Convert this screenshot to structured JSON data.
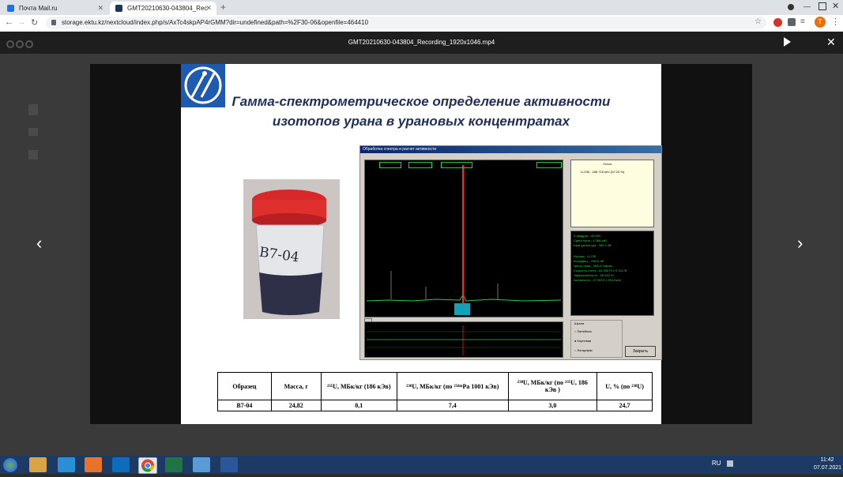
{
  "browser": {
    "tabs": [
      {
        "title": "Почта Mail.ru",
        "active": false,
        "favicon_color": "#1a73e8"
      },
      {
        "title": "GMT20210630-043804_Rec",
        "active": true,
        "favicon_color": "#1d3557"
      }
    ],
    "new_tab_symbol": "+",
    "url": "storage.ektu.kz/nextcloud/index.php/s/AxTc4skpAP4rGMM?dir=undefined&path=%2F30-06&openfile=464410",
    "profile_initial": "Т"
  },
  "viewer": {
    "title": "GMT20210630-043804_Recording_1920x1046.mp4",
    "close_symbol": "✕",
    "prev_symbol": "‹",
    "next_symbol": "›"
  },
  "slide": {
    "title_line1": "Гамма-спектрометрическое определение активности",
    "title_line2": "изотопов урана в урановых концентратах",
    "jar_label": "В7-04",
    "app": {
      "window_title": "Обработка спектра и расчет активности",
      "line_header": "Линия",
      "line_item": "U-235 - 185.715 keV (57.20 %)",
      "info_lines": [
        "Х-квадрат - 08.090",
        "Сдвиг нуля - 4.388 кэВ",
        "Шум детектора - 360.0 эВ",
        "",
        "Нуклид - U-235",
        "Коэффиц. - 692.6 эВ",
        "Центр пика - 933.47 канал",
        "Скорость счета - 83.90679 ± 0.31178",
        "Эффективность - 15.243 %",
        "Активность - 47.9872 ± 994 Бк/кг"
      ],
      "scale_label": "Шкала",
      "scale_options": [
        "Линейная",
        "Корневая",
        "Логарифм."
      ],
      "selected_scale": "Корневая",
      "close_button": "Закрыть"
    },
    "table": {
      "headers": [
        "Образец",
        "Масса, г",
        "²³⁵U, МБк/кг (186 кЭв)",
        "²³⁸U, МБк/кг (по ²³⁴ᵐPa 1001 кЭв)",
        "²³⁸U, МБк/кг (по ²³⁵U, 186 кЭв )",
        "U, % (по ²³⁸U)"
      ],
      "rows": [
        [
          "В7-04",
          "24,82",
          "0,1",
          "7,4",
          "3,0",
          "24,7"
        ]
      ]
    }
  },
  "taskbar": {
    "language": "RU",
    "time": "11:42",
    "date": "07.07.2021"
  },
  "colors": {
    "slide_title": "#1f2e5a",
    "spectrum_line": "#2ecc40",
    "peak": "#ff2a1a",
    "taskbar": "#1c3a63"
  }
}
